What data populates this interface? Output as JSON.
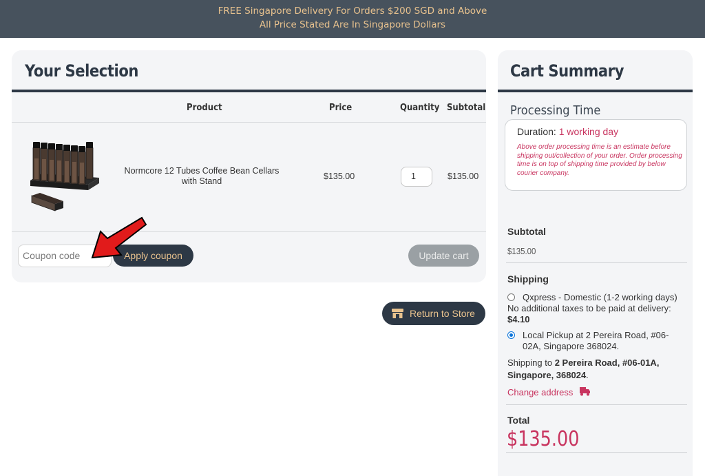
{
  "banner": {
    "line1": "FREE Singapore Delivery For Orders $200 SGD and Above",
    "line2": "All Price Stated Are In Singapore Dollars"
  },
  "selection": {
    "title": "Your Selection",
    "headers": {
      "product": "Product",
      "price": "Price",
      "quantity": "Quantity",
      "subtotal": "Subtotal"
    },
    "items": [
      {
        "name": "Normcore 12 Tubes Coffee Bean Cellars with Stand",
        "price": "$135.00",
        "quantity": "1",
        "subtotal": "$135.00"
      }
    ],
    "coupon_placeholder": "Coupon code",
    "apply_label": "Apply coupon",
    "update_label": "Update cart",
    "return_label": "Return to Store"
  },
  "summary": {
    "title": "Cart Summary",
    "processing_title": "Processing Time",
    "duration_label": "Duration:",
    "duration_value": "1 working day",
    "processing_note": "Above order processing time is an estimate before shipping out/collection of your order. Order processing time is on top of shipping time provided by below courier company.",
    "subtotal_label": "Subtotal",
    "subtotal_value": "$135.00",
    "shipping_label": "Shipping",
    "option1_label": "Qxpress - Domestic (1-2 working days)",
    "option1_note": "No additional taxes to be paid at delivery:",
    "option1_price": "$4.10",
    "option2_label": "Local Pickup at 2 Pereira Road, #06-02A, Singapore 368024.",
    "shipping_to_prefix": "Shipping to",
    "shipping_to_address": "2 Pereira Road, #06-01A, Singapore, 368024",
    "change_address": "Change address",
    "total_label": "Total",
    "total_value": "$135.00"
  },
  "colors": {
    "banner_bg": "#47525d",
    "banner_text": "#e8c28e",
    "dark": "#2d3845",
    "accent": "#c8345f",
    "radio_selected": "#0a74da"
  }
}
